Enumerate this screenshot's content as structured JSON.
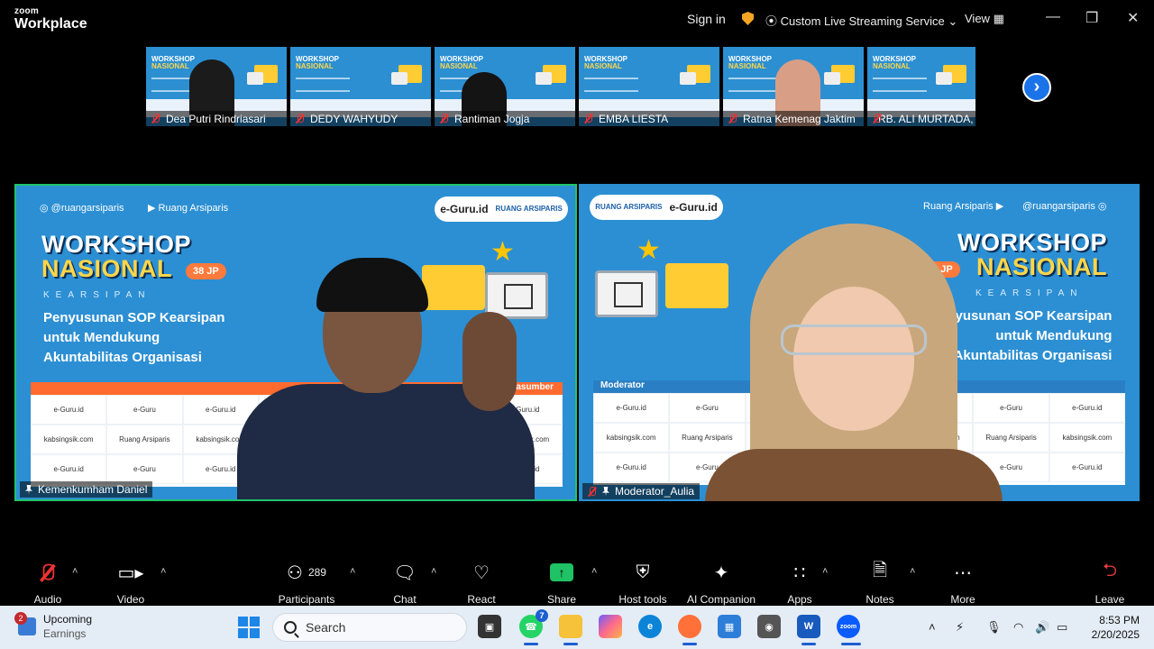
{
  "titlebar": {
    "brand_small": "zoom",
    "brand_big": "Workplace",
    "signin": "Sign in",
    "streaming": "Custom Live Streaming Service",
    "view": "View"
  },
  "thumbnails": [
    {
      "name": "Dea Putri Rindriasari",
      "muted": true
    },
    {
      "name": "DEDY WAHYUDY",
      "muted": true
    },
    {
      "name": "Rantiman Jogja",
      "muted": true
    },
    {
      "name": "EMBA LIESTA",
      "muted": true
    },
    {
      "name": "Ratna Kemenag Jaktim",
      "muted": true
    },
    {
      "name": "RB. ALI MURTADA, SE",
      "muted": true
    }
  ],
  "slide": {
    "instagram": "@ruangarsiparis",
    "youtube": "Ruang Arsiparis",
    "eguru": "e-Guru.id",
    "ruang_arsiparis": "RUANG ARSIPARIS",
    "workshop_line1": "WORKSHOP",
    "workshop_line2": "NASIONAL",
    "jp": "38 JP",
    "kearsipan": "KEARSIPAN",
    "subtitle_1": "Penyusunan SOP Kearsipan",
    "subtitle_2": "untuk Mendukung",
    "subtitle_3": "Akuntabilitas Organisasi",
    "narasumber": "Narasumber",
    "moderator": "Moderator",
    "grid_cells": [
      "e-Guru.id",
      "e-Guru",
      "e-Guru.id",
      "e-Guru",
      "e-Guru.id",
      "e-Guru",
      "e-Guru.id",
      "kabsingsik.com",
      "Ruang Arsiparis",
      "kabsingsik.com",
      "Ruang Arsiparis",
      "kabsingsik.com",
      "Ruang Arsiparis",
      "kabsingsik.com",
      "e-Guru.id",
      "e-Guru",
      "e-Guru.id",
      "e-Guru",
      "e-Guru.id",
      "e-Guru",
      "e-Guru.id"
    ]
  },
  "tiles": {
    "left_name": "Kemenkumham Daniel",
    "right_name": "Moderator_Aulia"
  },
  "toolbar": {
    "audio": "Audio",
    "video": "Video",
    "participants": "Participants",
    "participants_count": "289",
    "chat": "Chat",
    "react": "React",
    "share": "Share",
    "host_tools": "Host tools",
    "ai_companion": "AI Companion",
    "apps": "Apps",
    "notes": "Notes",
    "more": "More",
    "leave": "Leave"
  },
  "taskbar": {
    "weather_badge": "2",
    "upcoming": "Upcoming",
    "earnings": "Earnings",
    "search_placeholder": "Search",
    "whatsapp_badge": "7",
    "zoom_label": "zoom",
    "word_label": "W",
    "time": "8:53 PM",
    "date": "2/20/2025"
  },
  "colors": {
    "slide_blue": "#2c8fd3",
    "active_speaker": "#21c46b",
    "share_green": "#1fc264",
    "leave_red": "#e33b3b"
  }
}
